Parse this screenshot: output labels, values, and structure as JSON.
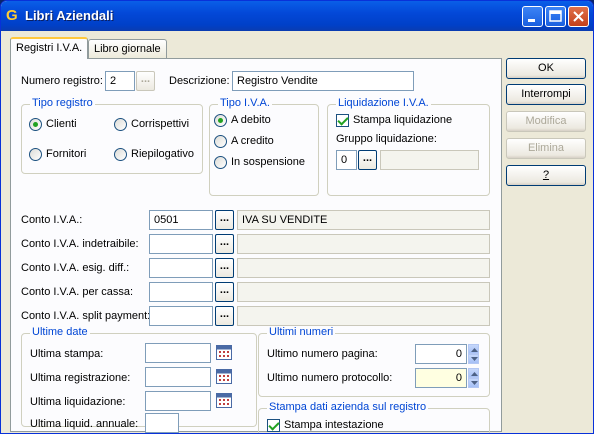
{
  "window": {
    "title": "Libri Aziendali",
    "icon_glyph": "G"
  },
  "tabs": [
    "Registri I.V.A.",
    "Libro giornale"
  ],
  "header": {
    "numero_registro_label": "Numero registro:",
    "numero_registro_value": "2",
    "descrizione_label": "Descrizione:",
    "descrizione_value": "Registro Vendite"
  },
  "tipo_registro": {
    "title": "Tipo registro",
    "options": [
      "Clienti",
      "Corrispettivi",
      "Fornitori",
      "Riepilogativo"
    ],
    "selected": "Clienti"
  },
  "tipo_iva": {
    "title": "Tipo I.V.A.",
    "options": [
      "A debito",
      "A credito",
      "In sospensione"
    ],
    "selected": "A debito"
  },
  "liquidazione": {
    "title": "Liquidazione I.V.A.",
    "stampa_label": "Stampa liquidazione",
    "stampa_checked": true,
    "gruppo_label": "Gruppo liquidazione:",
    "gruppo_value": "0"
  },
  "conti": [
    {
      "label": "Conto I.V.A.:",
      "code": "0501",
      "desc": "IVA SU VENDITE"
    },
    {
      "label": "Conto I.V.A. indetraibile:",
      "code": "",
      "desc": ""
    },
    {
      "label": "Conto I.V.A. esig. diff.:",
      "code": "",
      "desc": ""
    },
    {
      "label": "Conto I.V.A. per cassa:",
      "code": "",
      "desc": ""
    },
    {
      "label": "Conto I.V.A. split payment:",
      "code": "",
      "desc": ""
    }
  ],
  "ultime_date": {
    "title": "Ultime date",
    "ultima_stampa": "Ultima stampa:",
    "ultima_registrazione": "Ultima registrazione:",
    "ultima_liquidazione": "Ultima liquidazione:",
    "ultima_liquid_annuale": "Ultima liquid. annuale:"
  },
  "ultimi_numeri": {
    "title": "Ultimi numeri",
    "pagina_label": "Ultimo numero pagina:",
    "pagina_value": "0",
    "protocollo_label": "Ultimo numero protocollo:",
    "protocollo_value": "0"
  },
  "stampa_dati": {
    "title": "Stampa dati azienda sul registro",
    "intestazione_label": "Stampa intestazione",
    "intestazione_checked": true
  },
  "buttons": {
    "ok": "OK",
    "interrompi": "Interrompi",
    "modifica": "Modifica",
    "elimina": "Elimina",
    "help": "?"
  },
  "dots_label": "...",
  "colors": {
    "group_title": "#0046d5",
    "titlebar": "#0348d8",
    "check_green": "#21a121"
  }
}
